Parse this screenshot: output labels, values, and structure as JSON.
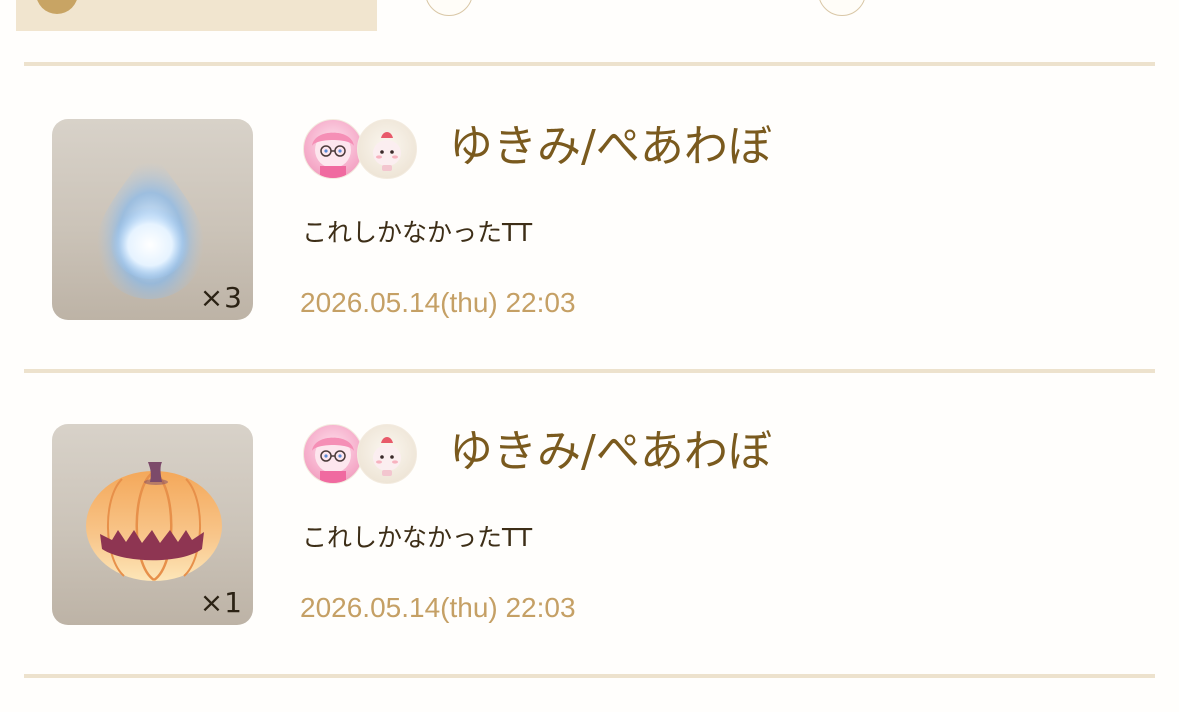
{
  "tabs": [
    {
      "label": "",
      "active": true
    },
    {
      "label": "",
      "active": false
    },
    {
      "label": "",
      "active": false
    }
  ],
  "colors": {
    "accent": "#c8a464",
    "active_tab_bg": "#f1e5cf",
    "divider": "#ede2cd",
    "username": "#7a5a1e",
    "timestamp": "#c5a065"
  },
  "entries": [
    {
      "item_icon": "blue-flame-orb-icon",
      "quantity": "×3",
      "avatars": [
        "user-avatar-pink-glasses",
        "user-avatar-cream-creature"
      ],
      "username": "ゆきみ/ぺあわぼ",
      "message": "これしかなかったTT",
      "timestamp": "2026.05.14(thu) 22:03"
    },
    {
      "item_icon": "jack-o-lantern-pumpkin-icon",
      "quantity": "×1",
      "avatars": [
        "user-avatar-pink-glasses",
        "user-avatar-cream-creature"
      ],
      "username": "ゆきみ/ぺあわぼ",
      "message": "これしかなかったTT",
      "timestamp": "2026.05.14(thu) 22:03"
    }
  ]
}
